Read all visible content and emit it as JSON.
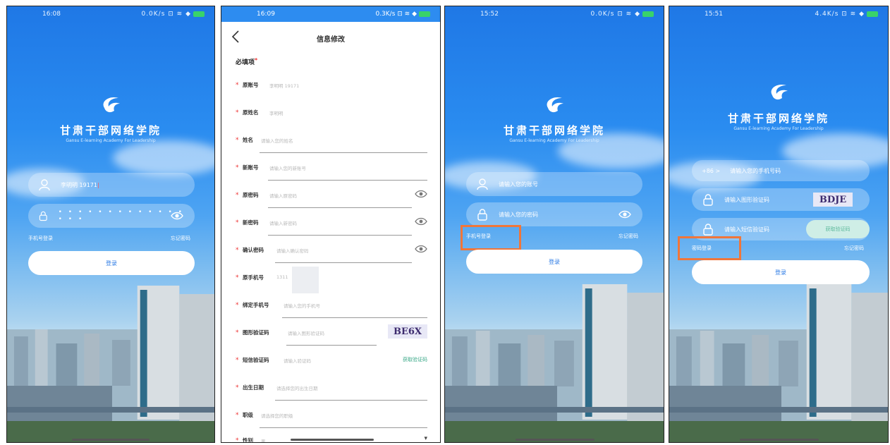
{
  "screens": {
    "login_password": {
      "time": "16:08",
      "net": "0.0K/s",
      "brand_title": "甘肃干部网络学院",
      "brand_sub": "Gansu E-learning Academy For Leadership",
      "account_value": "李明明 19171",
      "password_dots": "• • • • • • • • • • • • • • • •",
      "link_left": "手机号登录",
      "link_right": "忘记密码",
      "login_btn": "登录"
    },
    "edit_info": {
      "time": "16:09",
      "net": "0.3K/s",
      "title": "信息修改",
      "required": "必填项",
      "fields": [
        {
          "label": "原账号",
          "placeholder": "李明明 19171"
        },
        {
          "label": "原姓名",
          "placeholder": "李明明"
        },
        {
          "label": "姓名",
          "placeholder": "请输入您的姓名"
        },
        {
          "label": "新账号",
          "placeholder": "请输入您的新账号"
        },
        {
          "label": "原密码",
          "placeholder": "请输入原密码"
        },
        {
          "label": "新密码",
          "placeholder": "请输入新密码"
        },
        {
          "label": "确认密码",
          "placeholder": "请输入确认密码"
        },
        {
          "label": "原手机号",
          "placeholder": "1311"
        },
        {
          "label": "绑定手机号",
          "placeholder": "请输入您的手机号"
        },
        {
          "label": "图形验证码",
          "placeholder": "请输入图形验证码"
        },
        {
          "label": "短信验证码",
          "placeholder": "请输入验证码"
        },
        {
          "label": "出生日期",
          "placeholder": "请选择您的出生日期"
        },
        {
          "label": "职级",
          "placeholder": "请选择您的职级"
        },
        {
          "label": "性别",
          "placeholder": "男"
        }
      ],
      "captcha": "BE6X",
      "sms_btn": "获取验证码"
    },
    "login_account": {
      "time": "15:52",
      "net": "0.0K/s",
      "brand_title": "甘肃干部网络学院",
      "brand_sub": "Gansu E-learning Academy For Leadership",
      "account_placeholder": "请输入您的账号",
      "password_placeholder": "请输入您的密码",
      "link_left": "手机号登录",
      "link_right": "忘记密码",
      "login_btn": "登录"
    },
    "login_phone": {
      "time": "15:51",
      "net": "4.4K/s",
      "brand_title": "甘肃干部网络学院",
      "brand_sub": "Gansu E-learning Academy For Leadership",
      "country_code": "+86 >",
      "phone_placeholder": "请输入您的手机号码",
      "captcha_placeholder": "请输入图形验证码",
      "captcha": "BDJE",
      "sms_placeholder": "请输入短信验证码",
      "sms_btn": "获取验证码",
      "link_left": "密码登录",
      "link_right": "忘记密码",
      "login_btn": "登录"
    }
  },
  "colors": {
    "highlight": "#f0763a",
    "brand_blue": "#2a8cf0",
    "sms_green": "#5bb89a"
  }
}
